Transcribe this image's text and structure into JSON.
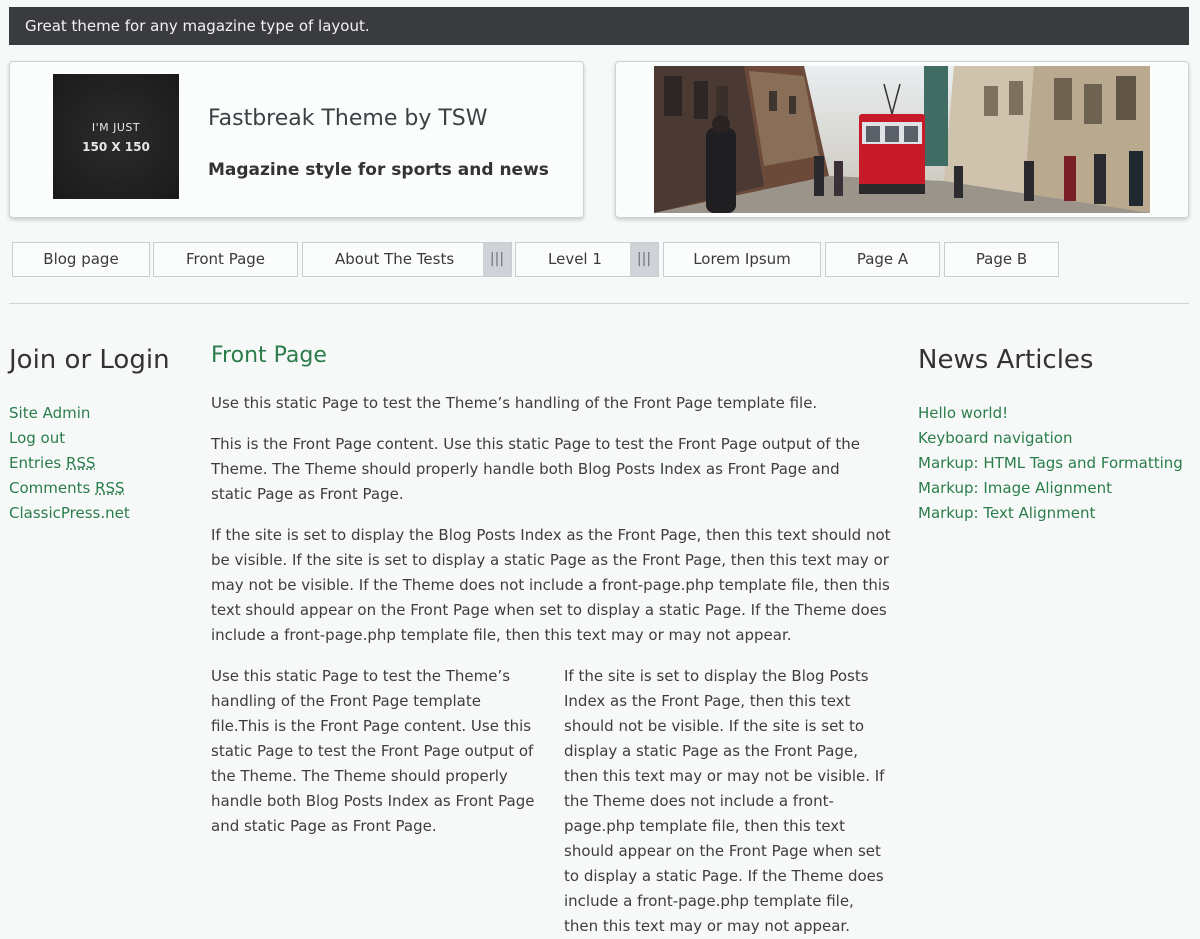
{
  "topbar": {
    "text": "Great theme for any magazine type of layout."
  },
  "header": {
    "logo": {
      "line1": "I'M JUST",
      "line2": "150 X 150"
    },
    "site_title": "Fastbreak Theme by TSW",
    "site_description": "Magazine style for sports and news"
  },
  "nav": {
    "items": [
      {
        "label": "Blog page"
      },
      {
        "label": "Front Page"
      },
      {
        "label": "About The Tests",
        "toggle": "|||"
      },
      {
        "label": "Level 1",
        "toggle": "|||"
      },
      {
        "label": "Lorem Ipsum"
      },
      {
        "label": "Page A"
      },
      {
        "label": "Page B"
      }
    ]
  },
  "left_sidebar": {
    "title": "Join or Login",
    "links": [
      {
        "label": "Site Admin"
      },
      {
        "label": "Log out"
      },
      {
        "label_pre": "Entries ",
        "abbr": "RSS"
      },
      {
        "label_pre": "Comments ",
        "abbr": "RSS"
      },
      {
        "label": "ClassicPress.net"
      }
    ]
  },
  "main": {
    "title": "Front Page",
    "p1": "Use this static Page to test the Theme’s handling of the Front Page template file.",
    "p2": "This is the Front Page content. Use this static Page to test the Front Page output of the Theme. The Theme should properly handle both Blog Posts Index as Front Page and static Page as Front Page.",
    "p3": "If the site is set to display the Blog Posts Index as the Front Page, then this text should not be visible. If the site is set to display a static Page as the Front Page, then this text may or may not be visible. If the Theme does not include a front-page.php template file, then this text should appear on the Front Page when set to display a static Page. If the Theme does include a front-page.php template file, then this text may or may not appear.",
    "col1": "Use this static Page to test the Theme’s handling of the Front Page template file.This is the Front Page content. Use this static Page to test the Front Page output of the Theme. The Theme should properly handle both Blog Posts Index as Front Page and static Page as Front Page.",
    "col2": "If the site is set to display the Blog Posts Index as the Front Page, then this text should not be visible. If the site is set to display a static Page as the Front Page, then this text may or may not be visible. If the Theme does not include a front-page.php template file, then this text should appear on the Front Page when set to display a static Page. If the Theme does include a front-page.php template file, then this text may or may not appear."
  },
  "right_sidebar": {
    "title": "News Articles",
    "links": [
      {
        "label": "Hello world!"
      },
      {
        "label": "Keyboard navigation"
      },
      {
        "label": "Markup: HTML Tags and Formatting"
      },
      {
        "label": "Markup: Image Alignment"
      },
      {
        "label": "Markup: Text Alignment"
      }
    ]
  },
  "colors": {
    "accent": "#2a7d4a",
    "topbar_bg": "#3a3b3e"
  }
}
